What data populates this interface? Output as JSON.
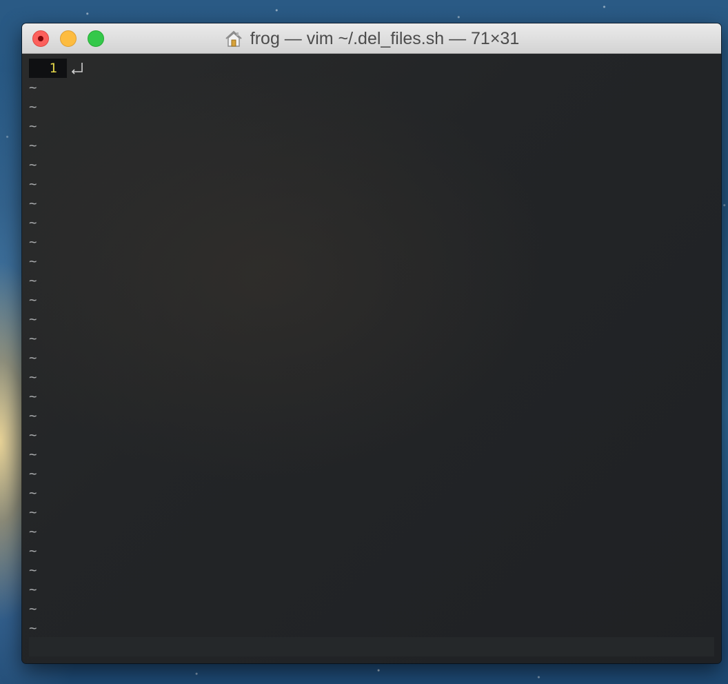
{
  "window": {
    "title": "frog — vim ~/.del_files.sh — 71×31",
    "title_icon": "home-icon",
    "traffic_lights": {
      "close_color": "#fc605c",
      "minimize_color": "#fdbc40",
      "zoom_color": "#34c84a"
    }
  },
  "editor": {
    "line_numbers": [
      "1"
    ],
    "line_number_color": "#e6d94a",
    "eol_icon": "return-arrow-icon",
    "empty_line_marker": "~",
    "empty_line_count": 29,
    "background_color": "#1f2124"
  },
  "statusline": {
    "text": ""
  }
}
